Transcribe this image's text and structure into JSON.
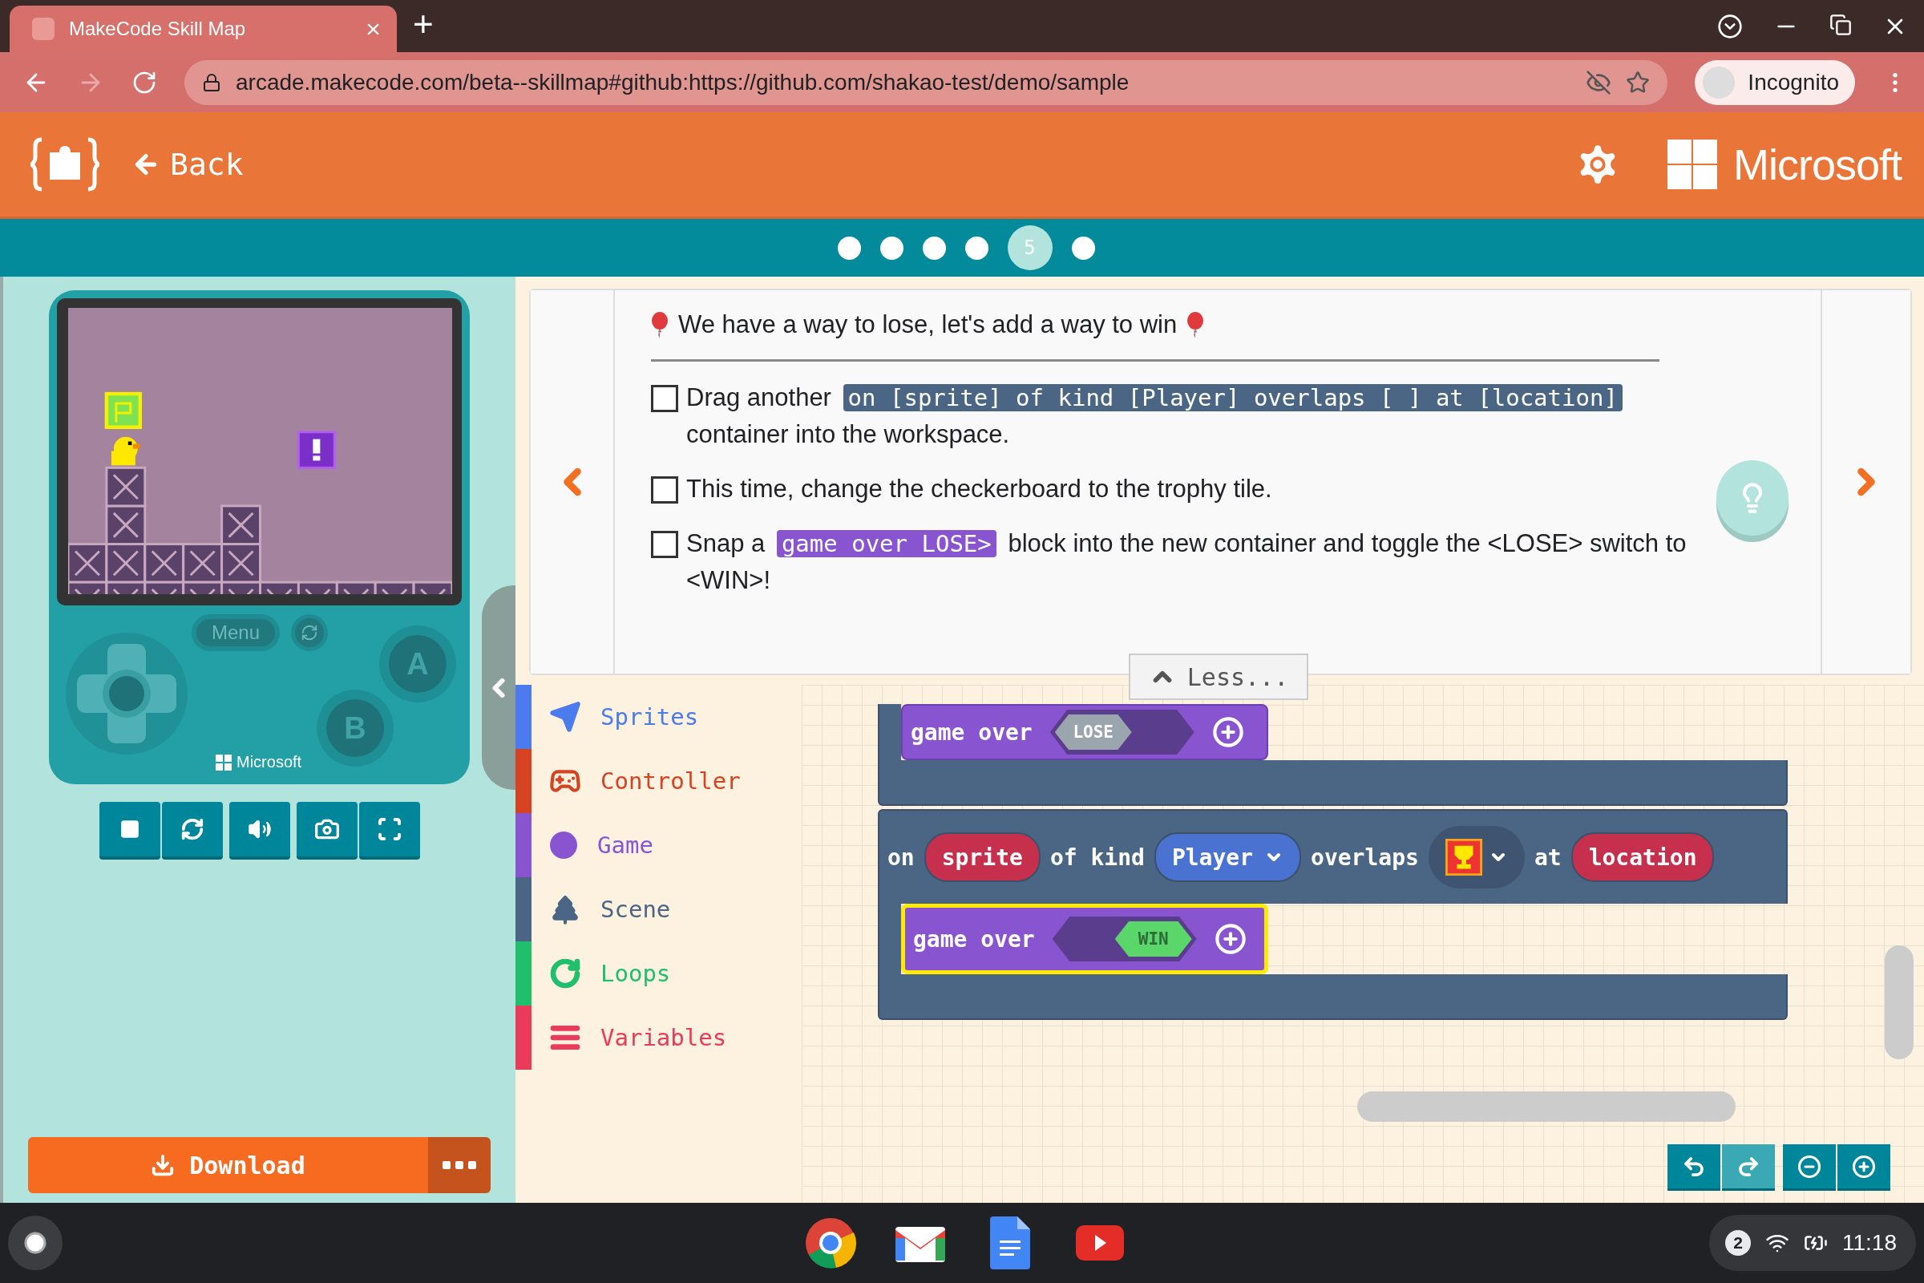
{
  "browser": {
    "tab": {
      "title": "MakeCode Skill Map",
      "close": "×"
    },
    "new_tab": "+",
    "url": "arcade.makecode.com/beta--skillmap#github:https://github.com/shakao-test/demo/sample",
    "profile": "Incognito"
  },
  "header": {
    "back": "Back",
    "brand": "Microsoft"
  },
  "progress": {
    "steps": [
      {
        "selected": false
      },
      {
        "selected": false
      },
      {
        "selected": false
      },
      {
        "selected": false
      },
      {
        "label": "5",
        "selected": true
      },
      {
        "selected": false
      }
    ]
  },
  "simulator": {
    "menu": "Menu",
    "buttons": [
      "A",
      "B"
    ],
    "brand": "Microsoft"
  },
  "download": {
    "label": "Download"
  },
  "instructions": {
    "title": "We have a way to lose, let's add a way to win",
    "tasks": [
      {
        "checked": false,
        "parts": [
          {
            "kind": "text",
            "text": "Drag another"
          },
          {
            "kind": "code",
            "text": "on [sprite] of kind [Player] overlaps [ ] at [location]",
            "color": "#4b6584"
          },
          {
            "kind": "text",
            "text": "container into the workspace."
          }
        ]
      },
      {
        "checked": false,
        "parts": [
          {
            "kind": "text",
            "text": "This time, change the checkerboard to the trophy tile."
          }
        ]
      },
      {
        "checked": false,
        "parts": [
          {
            "kind": "text",
            "text": "Snap a"
          },
          {
            "kind": "code",
            "text": "game over LOSE>",
            "color": "#8854d0"
          },
          {
            "kind": "text",
            "text": "block into the new container and toggle the <LOSE> switch to <WIN>!"
          }
        ]
      }
    ],
    "less": "Less..."
  },
  "toolbox": {
    "categories": [
      {
        "kind": "sprites",
        "name": "Sprites",
        "color": "#4b7bec"
      },
      {
        "kind": "controller",
        "name": "Controller",
        "color": "#d54322"
      },
      {
        "kind": "game",
        "name": "Game",
        "color": "#8854d0"
      },
      {
        "kind": "scene",
        "name": "Scene",
        "color": "#4b6584"
      },
      {
        "kind": "loops",
        "name": "Loops",
        "color": "#20bf6b"
      },
      {
        "kind": "variables",
        "name": "Variables",
        "color": "#eb3b5a"
      }
    ]
  },
  "workspace": {
    "top_block": {
      "label": "game over",
      "toggle": "LOSE",
      "win": false,
      "selected": false
    },
    "event": {
      "words": [
        "on",
        "of kind",
        "overlaps",
        "at"
      ],
      "sprite": "sprite",
      "sprite_kind": "Player",
      "location": "location",
      "inner": {
        "label": "game over",
        "toggle": "WIN",
        "win": true,
        "selected": true
      }
    }
  },
  "taskbar": {
    "notifications": "2",
    "time": "11:18"
  }
}
